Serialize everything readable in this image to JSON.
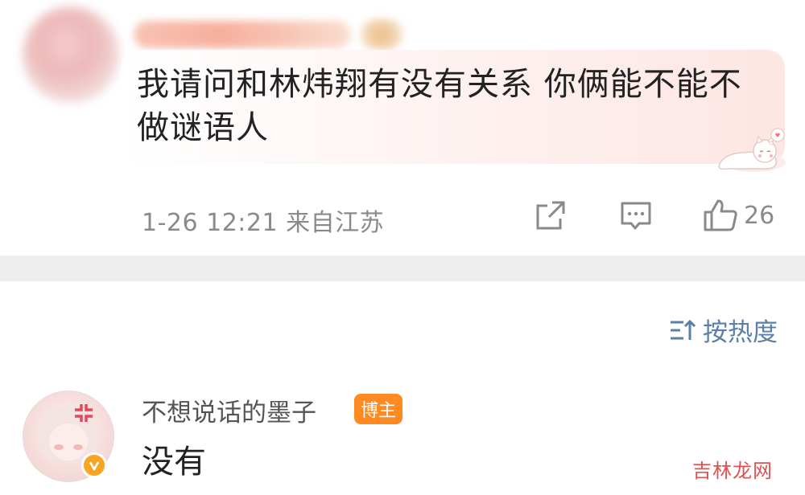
{
  "top_comment": {
    "text": "我请问和林炜翔有没有关系 你俩能不能不做谜语人",
    "meta_time": "1-26 12:21 来自江苏",
    "like_count": "26",
    "icons": {
      "share": "share-external-icon",
      "reply": "comment-icon",
      "like": "thumbs-up-icon",
      "sticker": "cat-sticker-icon"
    }
  },
  "sort": {
    "label": "按热度",
    "icon": "sort-icon"
  },
  "reply": {
    "username": "不想说话的墨子",
    "tag": "博主",
    "text": "没有",
    "verified_icon": "verified-badge-icon"
  },
  "watermark": "吉林龙网",
  "colors": {
    "tag_bg": "#ff8a22",
    "sort_text": "#5a7fa8",
    "meta_text": "#8a8a8a",
    "verified": "#f6a623",
    "watermark": "#e05050"
  }
}
